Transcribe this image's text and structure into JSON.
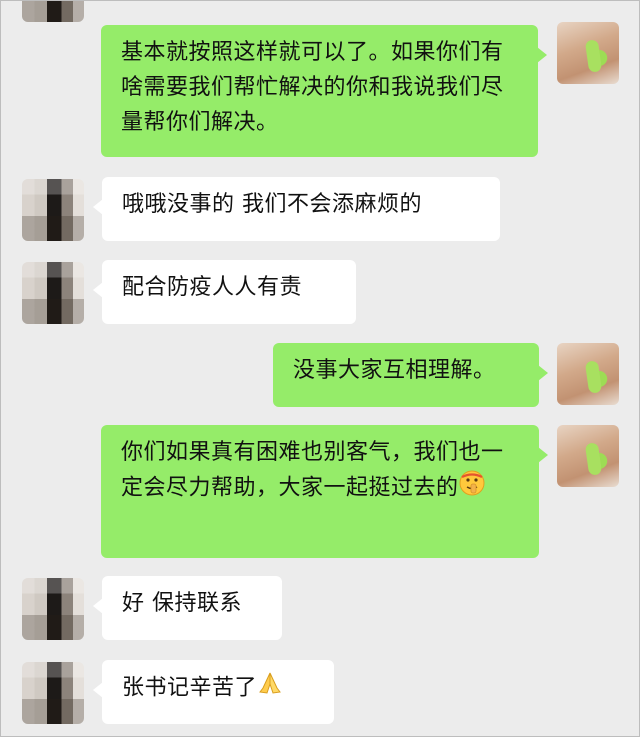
{
  "messages": [
    {
      "side": "right",
      "text": "基本就按照这样就可以了。如果你们有啥需要我们帮忙解决的你和我说我们尽量帮你们解决。"
    },
    {
      "side": "left",
      "text": "哦哦没事的 我们不会添麻烦的"
    },
    {
      "side": "left",
      "text": "配合防疫人人有责"
    },
    {
      "side": "right",
      "text": "没事大家互相理解。"
    },
    {
      "side": "right",
      "text": "你们如果真有困难也别客气，我们也一定会尽力帮助，大家一起挺过去的",
      "emoji": "shushing-face-emoji"
    },
    {
      "side": "left",
      "text": "好 保持联系"
    },
    {
      "side": "left",
      "text": "张书记辛苦了",
      "emoji": "folded-hands-emoji"
    }
  ],
  "colors": {
    "background": "#ececec",
    "sent_bubble": "#95ec69",
    "received_bubble": "#ffffff"
  }
}
